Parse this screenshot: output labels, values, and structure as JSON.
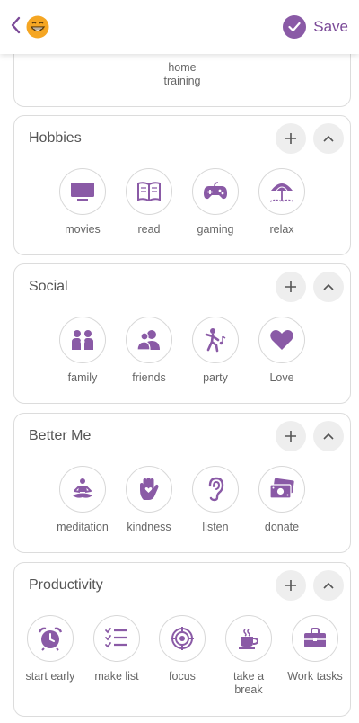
{
  "header": {
    "save_label": "Save"
  },
  "top_card": {
    "item_label_line1": "home",
    "item_label_line2": "training"
  },
  "categories": [
    {
      "title": "Hobbies",
      "items": [
        {
          "label": "movies",
          "icon": "tv-icon"
        },
        {
          "label": "read",
          "icon": "book-icon"
        },
        {
          "label": "gaming",
          "icon": "gamepad-icon"
        },
        {
          "label": "relax",
          "icon": "beach-umbrella-icon"
        }
      ]
    },
    {
      "title": "Social",
      "items": [
        {
          "label": "family",
          "icon": "family-icon"
        },
        {
          "label": "friends",
          "icon": "friends-icon"
        },
        {
          "label": "party",
          "icon": "dancer-icon"
        },
        {
          "label": "Love",
          "icon": "heart-icon"
        }
      ]
    },
    {
      "title": "Better Me",
      "items": [
        {
          "label": "meditation",
          "icon": "meditation-icon"
        },
        {
          "label": "kindness",
          "icon": "hand-heart-icon"
        },
        {
          "label": "listen",
          "icon": "ear-icon"
        },
        {
          "label": "donate",
          "icon": "money-icon"
        }
      ]
    },
    {
      "title": "Productivity",
      "items": [
        {
          "label": "start early",
          "icon": "alarm-clock-icon"
        },
        {
          "label": "make list",
          "icon": "checklist-icon"
        },
        {
          "label": "focus",
          "icon": "target-icon"
        },
        {
          "label": "take a\nbreak",
          "icon": "coffee-cup-icon"
        },
        {
          "label": "Work tasks",
          "icon": "briefcase-icon"
        }
      ]
    }
  ],
  "colors": {
    "accent": "#7b4a98",
    "icon": "#8a5aa6",
    "border": "#dcdcdc"
  }
}
